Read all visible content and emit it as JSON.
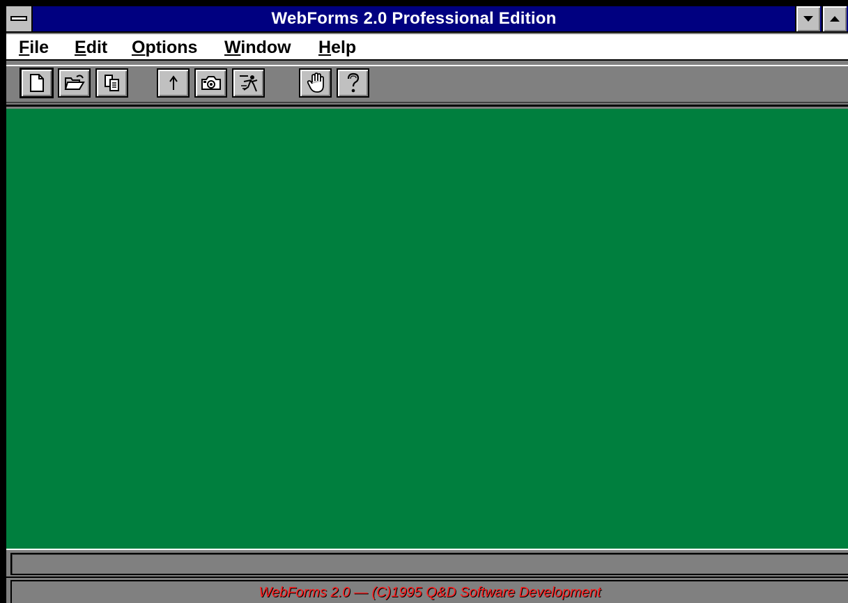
{
  "window": {
    "title": "WebForms 2.0 Professional Edition",
    "minimize_icon": "minimize-arrow-icon",
    "maximize_icon": "maximize-arrow-icon"
  },
  "menubar": {
    "items": [
      {
        "label": "File"
      },
      {
        "label": "Edit"
      },
      {
        "label": "Options"
      },
      {
        "label": "Window"
      },
      {
        "label": "Help"
      }
    ]
  },
  "toolbar": {
    "buttons": [
      {
        "icon": "new-document-icon"
      },
      {
        "icon": "open-folder-icon"
      },
      {
        "icon": "copy-pages-icon"
      },
      {
        "icon": "up-arrow-icon"
      },
      {
        "icon": "camera-icon"
      },
      {
        "icon": "running-figure-icon"
      },
      {
        "icon": "hand-icon"
      },
      {
        "icon": "help-question-icon"
      }
    ]
  },
  "client": {
    "background_color": "#007f3e"
  },
  "status": {
    "line1": "",
    "copyright": "WebForms 2.0 — (C)1995 Q&D Software Development",
    "copyright_color": "#ff2020"
  },
  "colors": {
    "title_bar": "#000080",
    "chrome": "#c0c0c0",
    "toolbar_bg": "#808080"
  }
}
